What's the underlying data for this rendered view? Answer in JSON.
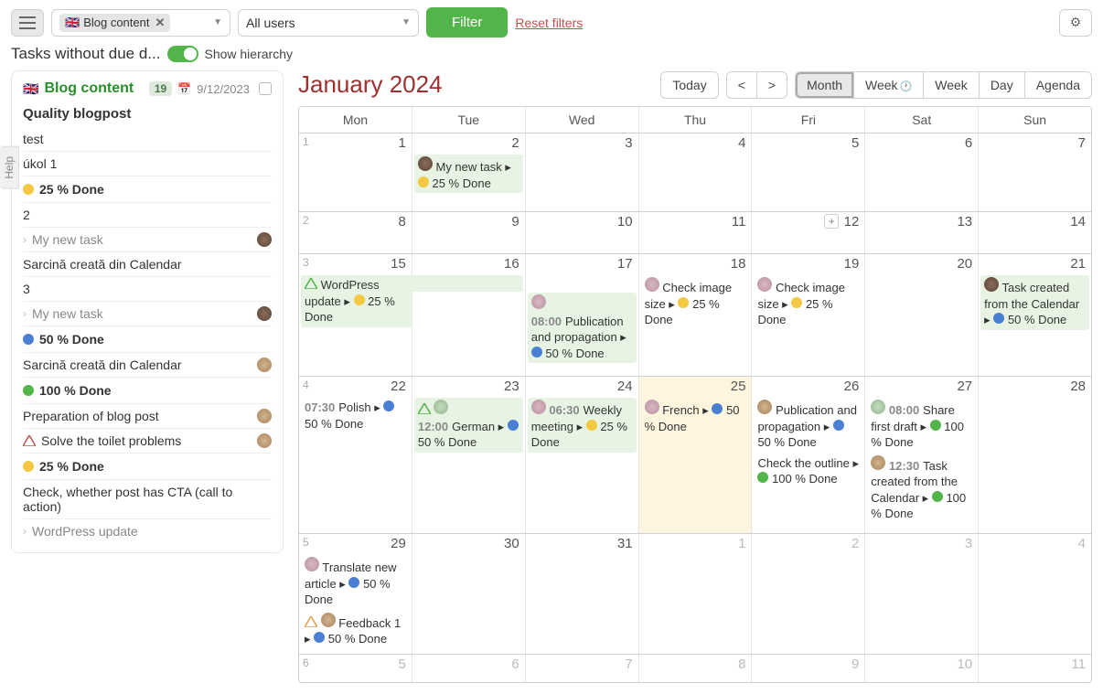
{
  "topbar": {
    "project_chip": "Blog content",
    "users_dropdown": "All users",
    "filter_btn": "Filter",
    "reset_link": "Reset filters"
  },
  "subbar": {
    "title": "Tasks without due d...",
    "toggle_label": "Show hierarchy"
  },
  "help_tab": "Help",
  "sidebar": {
    "project": "Blog content",
    "badge": "19",
    "date": "9/12/2023",
    "section_quality": "Quality blogpost",
    "tasks1": [
      "test",
      "úkol 1"
    ],
    "status25": "25 % Done",
    "t_2": "2",
    "t_new1": "My new task",
    "t_sarcina1": "Sarcină creată din Calendar",
    "t_3": "3",
    "t_new2": "My new task",
    "status50": "50 % Done",
    "t_sarcina2": "Sarcină creată din Calendar",
    "status100": "100 % Done",
    "t_prep": "Preparation of blog post",
    "t_toilet": "Solve the toilet problems",
    "status25b": "25 % Done",
    "t_cta": "Check, whether post has CTA (call to action)",
    "t_wp": "WordPress update"
  },
  "calendar": {
    "title": "January 2024",
    "today": "Today",
    "prev": "<",
    "next": ">",
    "views": [
      "Month",
      "Week",
      "Week",
      "Day",
      "Agenda"
    ],
    "dow": [
      "Mon",
      "Tue",
      "Wed",
      "Thu",
      "Fri",
      "Sat",
      "Sun"
    ],
    "week_nums": [
      "1",
      "2",
      "3",
      "4",
      "5",
      "6"
    ],
    "days": {
      "w1": [
        "1",
        "2",
        "3",
        "4",
        "5",
        "6",
        "7"
      ],
      "w2": [
        "8",
        "9",
        "10",
        "11",
        "12",
        "13",
        "14"
      ],
      "w3": [
        "15",
        "16",
        "17",
        "18",
        "19",
        "20",
        "21"
      ],
      "w4": [
        "22",
        "23",
        "24",
        "25",
        "26",
        "27",
        "28"
      ],
      "w5": [
        "29",
        "30",
        "31",
        "1",
        "2",
        "3",
        "4"
      ],
      "w6": [
        "5",
        "6",
        "7",
        "8",
        "9",
        "10",
        "11"
      ]
    },
    "events": {
      "e1": "My new task ▸",
      "e1b": "25 % Done",
      "e2": "WordPress update ▸",
      "e2b": "25 % Done",
      "e3t": "08:00",
      "e3": "Publication and propagation ▸",
      "e3b": "50 % Done",
      "e4": "Check image size ▸",
      "e4b": "25 % Done",
      "e5": "Check image size ▸",
      "e5b": "25 % Done",
      "e6": "Task created from the Calendar ▸",
      "e6b": "50 % Done",
      "e7t": "07:30",
      "e7": "Polish ▸",
      "e7b": "50 % Done",
      "e8t": "12:00",
      "e8": "German ▸",
      "e8b": "50 % Done",
      "e9t": "06:30",
      "e9": "Weekly meeting ▸",
      "e9b": "25 % Done",
      "e10": "French ▸",
      "e10b": "50 % Done",
      "e11": "Publication and propagation ▸",
      "e11b": "50 % Done",
      "e12": "Check the outline ▸",
      "e12b": "100 % Done",
      "e13t": "08:00",
      "e13": "Share first draft ▸",
      "e13b": "100 % Done",
      "e14t": "12:30",
      "e14": "Task created from the Calendar ▸",
      "e14b": "100 % Done",
      "e15": "Translate new article ▸",
      "e15b": "50 % Done",
      "e16": "Feedback 1 ▸",
      "e16b": "50 % Done"
    }
  }
}
